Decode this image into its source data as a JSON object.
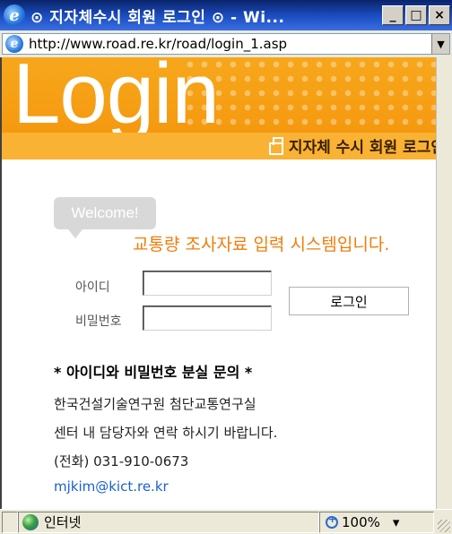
{
  "window": {
    "title": "⊙ 지자체수시 회원 로그인 ⊙ - Wi...",
    "minimize_label": "_",
    "maximize_label": "□",
    "close_label": "×"
  },
  "address_bar": {
    "url": "http://www.road.re.kr/road/login_1.asp"
  },
  "banner": {
    "title": "Login",
    "subtitle": "지자체 수시 회원 로그인"
  },
  "welcome": {
    "bubble": "Welcome!",
    "system_text": "교통량 조사자료 입력 시스템입니다."
  },
  "form": {
    "id_label": "아이디",
    "password_label": "비밀번호",
    "id_value": "",
    "password_value": "",
    "login_button": "로그인"
  },
  "info": {
    "title": "* 아이디와 비밀번호 분실 문의 *",
    "line1": "한국건설기술연구원 첨단교통연구실",
    "line2": "센터 내 담당자와 연락 하시기 바랍니다.",
    "line3": "(전화) 031-910-0673",
    "email": "mjkim@kict.re.kr"
  },
  "status_bar": {
    "zone": "인터넷",
    "zoom": "100%",
    "zoom_dropdown": "▾"
  },
  "colors": {
    "accent_orange": "#f59a10",
    "system_text": "#f07d0a",
    "link_blue": "#1a5fd6"
  }
}
